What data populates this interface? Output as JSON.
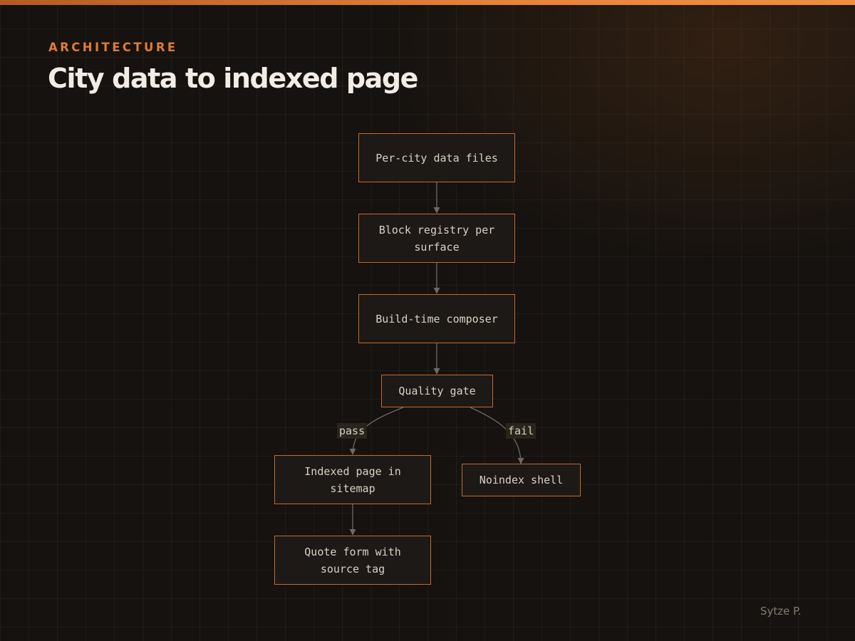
{
  "header": {
    "eyebrow": "ARCHITECTURE",
    "title": "City data to indexed page"
  },
  "diagram": {
    "nodes": {
      "city_data": "Per-city data files",
      "block_registry": "Block registry per surface",
      "composer": "Build-time composer",
      "quality_gate": "Quality gate",
      "indexed_page": "Indexed page in sitemap",
      "noindex_shell": "Noindex shell",
      "quote_form": "Quote form with source tag"
    },
    "edge_labels": {
      "pass": "pass",
      "fail": "fail"
    },
    "colors": {
      "accent": "#e07b35",
      "node_border": "#c7682a",
      "node_fill": "#1d1916",
      "edge": "#6f6963"
    }
  },
  "footer": {
    "author": "Sytze P."
  }
}
